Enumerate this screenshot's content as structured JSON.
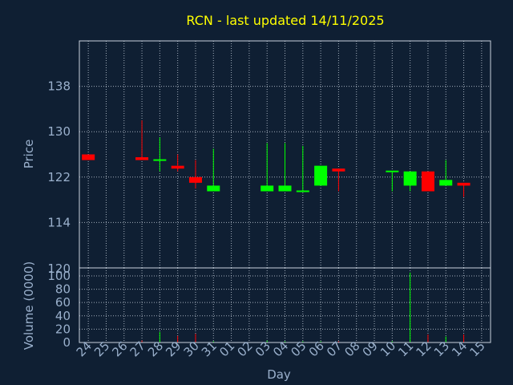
{
  "title": "RCN - last updated 14/11/2025",
  "chart_data": [
    {
      "type": "candlestick",
      "ylabel": "Price",
      "ylim": [
        106,
        146
      ],
      "yticks": [
        114,
        122,
        130,
        138
      ],
      "grid": true,
      "colors": {
        "up": "#00ff00",
        "down": "#ff0000"
      },
      "candles": [
        {
          "day": "24",
          "open": 126,
          "high": 126,
          "low": 125,
          "close": 125
        },
        {
          "day": "27",
          "open": 125.5,
          "high": 132,
          "low": 125,
          "close": 125
        },
        {
          "day": "28",
          "open": 125,
          "high": 129,
          "low": 123,
          "close": 125
        },
        {
          "day": "29",
          "open": 124,
          "high": 126,
          "low": 123,
          "close": 123.5
        },
        {
          "day": "30",
          "open": 122,
          "high": 125,
          "low": 120,
          "close": 121
        },
        {
          "day": "31",
          "open": 119.5,
          "high": 127,
          "low": 119.5,
          "close": 120.5
        },
        {
          "day": "03",
          "open": 119.5,
          "high": 128,
          "low": 119.5,
          "close": 120.5
        },
        {
          "day": "04",
          "open": 119.5,
          "high": 128,
          "low": 119.5,
          "close": 120.5
        },
        {
          "day": "05",
          "open": 119.5,
          "high": 127.5,
          "low": 119.5,
          "close": 119.5
        },
        {
          "day": "06",
          "open": 120.5,
          "high": 124,
          "low": 120.5,
          "close": 124
        },
        {
          "day": "07",
          "open": 123.5,
          "high": 123.5,
          "low": 119.5,
          "close": 123
        },
        {
          "day": "10",
          "open": 123,
          "high": 123,
          "low": 119.5,
          "close": 123
        },
        {
          "day": "11",
          "open": 120.5,
          "high": 123,
          "low": 119.5,
          "close": 123
        },
        {
          "day": "12",
          "open": 123,
          "high": 123,
          "low": 119.5,
          "close": 119.5
        },
        {
          "day": "13",
          "open": 120.5,
          "high": 125,
          "low": 120.5,
          "close": 121.5
        },
        {
          "day": "14",
          "open": 121,
          "high": 121,
          "low": 118.5,
          "close": 120.5
        }
      ]
    },
    {
      "type": "bar",
      "ylabel": "Volume (0000)",
      "ylim": [
        0,
        112
      ],
      "yticks": [
        0,
        20,
        40,
        60,
        80,
        100
      ],
      "extra_tick_label": "120",
      "grid": true,
      "volumes": [
        {
          "day": "24",
          "value": 0,
          "color": "#ff0000"
        },
        {
          "day": "27",
          "value": 3,
          "color": "#ff0000"
        },
        {
          "day": "28",
          "value": 16,
          "color": "#00ff00"
        },
        {
          "day": "29",
          "value": 10,
          "color": "#ff0000"
        },
        {
          "day": "30",
          "value": 13,
          "color": "#ff0000"
        },
        {
          "day": "31",
          "value": 2,
          "color": "#00ff00"
        },
        {
          "day": "03",
          "value": 3,
          "color": "#00ff00"
        },
        {
          "day": "04",
          "value": 2,
          "color": "#00ff00"
        },
        {
          "day": "05",
          "value": 2,
          "color": "#00ff00"
        },
        {
          "day": "06",
          "value": 2,
          "color": "#00ff00"
        },
        {
          "day": "07",
          "value": 2,
          "color": "#ff0000"
        },
        {
          "day": "10",
          "value": 2,
          "color": "#00ff00"
        },
        {
          "day": "11",
          "value": 105,
          "color": "#00ff00"
        },
        {
          "day": "12",
          "value": 12,
          "color": "#ff0000"
        },
        {
          "day": "13",
          "value": 9,
          "color": "#00ff00"
        },
        {
          "day": "14",
          "value": 12,
          "color": "#ff0000"
        }
      ]
    }
  ],
  "xaxis": {
    "label": "Day",
    "ticks": [
      "24",
      "25",
      "26",
      "27",
      "28",
      "29",
      "30",
      "31",
      "01",
      "02",
      "03",
      "04",
      "05",
      "06",
      "07",
      "08",
      "09",
      "10",
      "11",
      "12",
      "13",
      "14",
      "15"
    ]
  }
}
